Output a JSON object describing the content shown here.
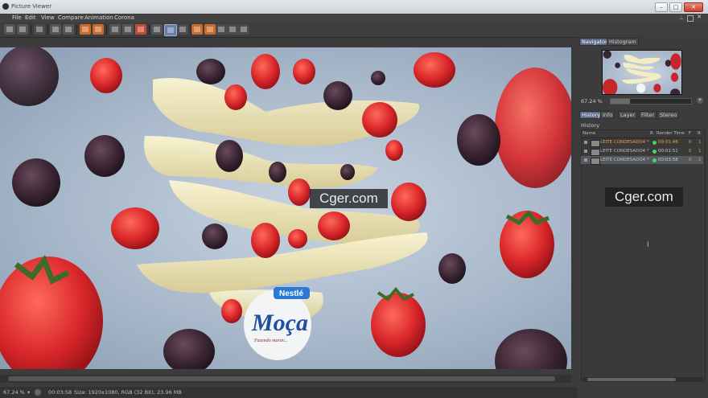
{
  "window": {
    "title": "Picture Viewer"
  },
  "menu": [
    "File",
    "Edit",
    "View",
    "Compare",
    "Animation",
    "Corona"
  ],
  "watermark": "Cger.com",
  "navigator": {
    "tabs": [
      "Navigator",
      "Histogram"
    ],
    "zoom": "67.24 %"
  },
  "panel_tabs": [
    "History",
    "Info",
    "Layer",
    "Filter",
    "Stereo"
  ],
  "history": {
    "header": "History",
    "columns": {
      "name": "Name",
      "r": "R",
      "render_time": "Render Time",
      "f": "F",
      "r2": "R"
    },
    "rows": [
      {
        "name": "LEITE CONDESADO4 *",
        "time": "00:01:48",
        "f": "0",
        "r": "1"
      },
      {
        "name": "LEITE CONDESADO4 *",
        "time": "00:01:51",
        "f": "0",
        "r": "1"
      },
      {
        "name": "LEITE CONDESADO4 *",
        "time": "00:03:58",
        "f": "0",
        "r": "1"
      }
    ]
  },
  "status": {
    "zoom": "67.24 %",
    "time": "00:03:58",
    "size": "Size: 1920x1080, RGB (32 Bit), 23.96 MB"
  },
  "image": {
    "brand": "Nestlé",
    "product": "Moça",
    "slogan": "Fazendo marav..."
  },
  "colors": {
    "accent_tab": "#5b6a86",
    "history_highlight": "#e6a03c",
    "status_dot": "#4dd06a"
  }
}
